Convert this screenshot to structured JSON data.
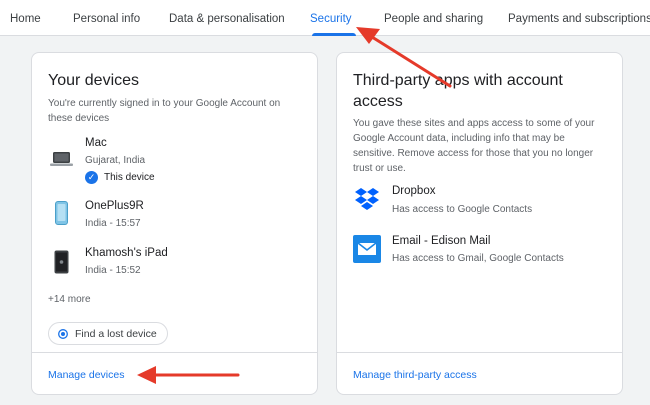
{
  "tabs": [
    "Home",
    "Personal info",
    "Data & personalisation",
    "Security",
    "People and sharing",
    "Payments and subscriptions"
  ],
  "active_tab": "Security",
  "accent": "#1a73e8",
  "annotation_color": "#e53a2a",
  "devices_card": {
    "title": "Your devices",
    "description": "You're currently signed in to your Google Account on these devices",
    "devices": [
      {
        "name": "Mac",
        "location": "Gujarat, India",
        "badge": "This device",
        "icon": "laptop-icon"
      },
      {
        "name": "OnePlus9R",
        "location": "India - 15:57",
        "icon": "phone-icon"
      },
      {
        "name": "Khamosh's iPad",
        "location": "India - 15:52",
        "icon": "tablet-icon"
      }
    ],
    "more": "+14 more",
    "find_button": "Find a lost device",
    "footer_link": "Manage devices"
  },
  "apps_card": {
    "title": "Third-party apps with account access",
    "description": "You gave these sites and apps access to some of your Google Account data, including info that may be sensitive. Remove access for those that you no longer trust or use.",
    "apps": [
      {
        "name": "Dropbox",
        "access": "Has access to Google Contacts",
        "icon": "dropbox-icon"
      },
      {
        "name": "Email - Edison Mail",
        "access": "Has access to Gmail, Google Contacts",
        "icon": "mail-icon"
      }
    ],
    "footer_link": "Manage third-party access"
  }
}
